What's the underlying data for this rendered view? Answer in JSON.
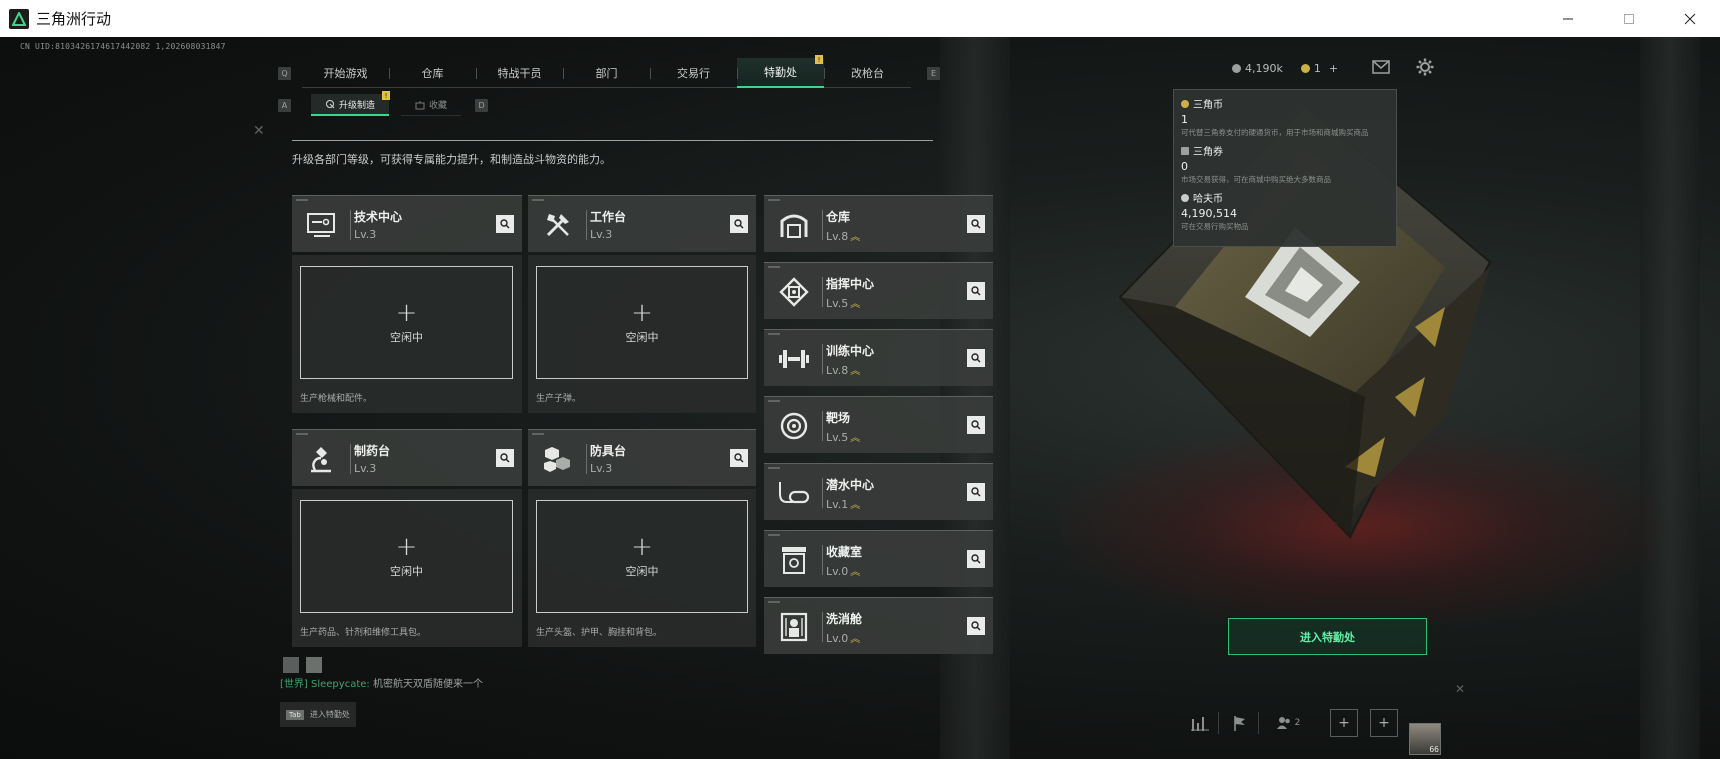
{
  "window": {
    "title": "三角洲行动",
    "controls": [
      "minimize",
      "maximize",
      "close"
    ]
  },
  "uid": "CN UID:8103426174617442082 1,202608031847",
  "nav": {
    "left_key": "Q",
    "right_key": "E",
    "tabs": [
      {
        "label": "开始游戏",
        "active": false
      },
      {
        "label": "仓库",
        "active": false
      },
      {
        "label": "特战干员",
        "active": false
      },
      {
        "label": "部门",
        "active": false
      },
      {
        "label": "交易行",
        "active": false
      },
      {
        "label": "特勤处",
        "active": true,
        "alert": "!"
      },
      {
        "label": "改枪台",
        "active": false
      }
    ]
  },
  "subnav": {
    "left_key": "A",
    "right_key": "D",
    "tabs": [
      {
        "label": "升级制造",
        "active": true,
        "alert": "!"
      },
      {
        "label": "收藏",
        "active": false
      }
    ]
  },
  "intro": "升级各部门等级，可获得专属能力提升，和制造战斗物资的能力。",
  "production_cards": [
    {
      "name": "技术中心",
      "level": "Lv.3",
      "icon": "monitor-icon",
      "slot_status": "空闲中",
      "description": "生产枪械和配件。"
    },
    {
      "name": "工作台",
      "level": "Lv.3",
      "icon": "tools-icon",
      "slot_status": "空闲中",
      "description": "生产子弹。"
    },
    {
      "name": "制药台",
      "level": "Lv.3",
      "icon": "microscope-icon",
      "slot_status": "空闲中",
      "description": "生产药品、针剂和维修工具包。"
    },
    {
      "name": "防具台",
      "level": "Lv.3",
      "icon": "armor-cubes-icon",
      "slot_status": "空闲中",
      "description": "生产头盔、护甲、胸挂和背包。"
    }
  ],
  "facility_cards": [
    {
      "name": "仓库",
      "level": "Lv.8",
      "icon": "warehouse-icon"
    },
    {
      "name": "指挥中心",
      "level": "Lv.5",
      "icon": "command-center-icon"
    },
    {
      "name": "训练中心",
      "level": "Lv.8",
      "icon": "dumbbell-icon"
    },
    {
      "name": "靶场",
      "level": "Lv.5",
      "icon": "target-icon"
    },
    {
      "name": "潜水中心",
      "level": "Lv.1",
      "icon": "diving-mask-icon"
    },
    {
      "name": "收藏室",
      "level": "Lv.0",
      "icon": "collection-icon"
    },
    {
      "name": "洗消舱",
      "level": "Lv.0",
      "icon": "decontamination-icon"
    }
  ],
  "level_up_mark": "︽",
  "plus_symbol": "+",
  "currency": {
    "hafu_amount": "4,190k",
    "sanjiao_amount": "1",
    "add": "+"
  },
  "tooltip": {
    "items": [
      {
        "name": "三角币",
        "value": "1",
        "note": "可代替三角券支付的硬通货币，用于市场和商城购买商品"
      },
      {
        "name": "三角券",
        "value": "0",
        "note": "市场交易获得，可在商城中购买绝大多数商品"
      },
      {
        "name": "哈夫币",
        "value": "4,190,514",
        "note": "可在交易行购买物品"
      }
    ]
  },
  "enter_button": "进入特勤处",
  "chat": {
    "channel": "[世界]",
    "user": "Sleepycate:",
    "message": "机密航天双盾随便来一个",
    "tab_key": "Tab",
    "tab_hint": "进入特勤处"
  },
  "bottom_bar": {
    "squad_count": "2",
    "player_level": "66"
  },
  "colors": {
    "accent": "#3fd58a",
    "alert": "#e0c248",
    "level_up": "#cdb047",
    "card_bg": "#383c3a"
  }
}
